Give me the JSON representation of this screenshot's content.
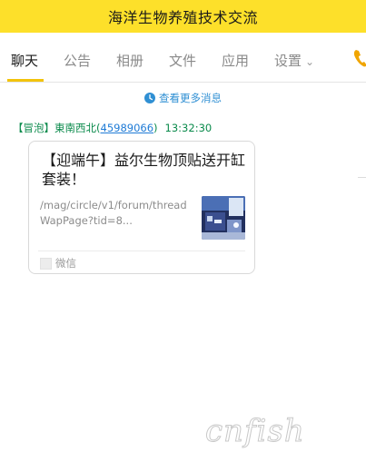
{
  "window": {
    "title": "海洋生物养殖技术交流"
  },
  "tabs": [
    {
      "label": "聊天",
      "active": true
    },
    {
      "label": "公告",
      "active": false
    },
    {
      "label": "相册",
      "active": false
    },
    {
      "label": "文件",
      "active": false
    },
    {
      "label": "应用",
      "active": false
    },
    {
      "label": "设置",
      "active": false
    }
  ],
  "chat": {
    "more_messages": "查看更多消息",
    "sender": {
      "tag": "【冒泡】",
      "name": "東南西北",
      "qq_open": "(",
      "qq": "45989066",
      "qq_close": ")",
      "time": "13:32:30"
    },
    "card": {
      "title": "【迎端午】益尔生物顶贴送开缸套装！",
      "url": "/mag/circle/v1/forum/threadWapPage?tid=8...",
      "source": "微信"
    }
  },
  "icons": {
    "settings_chevron": "chevron-down-icon",
    "phone": "phone-icon",
    "clock": "clock-icon"
  },
  "colors": {
    "title_bar": "#fde02a",
    "tab_active_underline": "#f2c30c",
    "link_blue": "#2f8fd3",
    "sender_green": "#0a8a4b"
  },
  "watermark": {
    "text": "cnfish"
  }
}
